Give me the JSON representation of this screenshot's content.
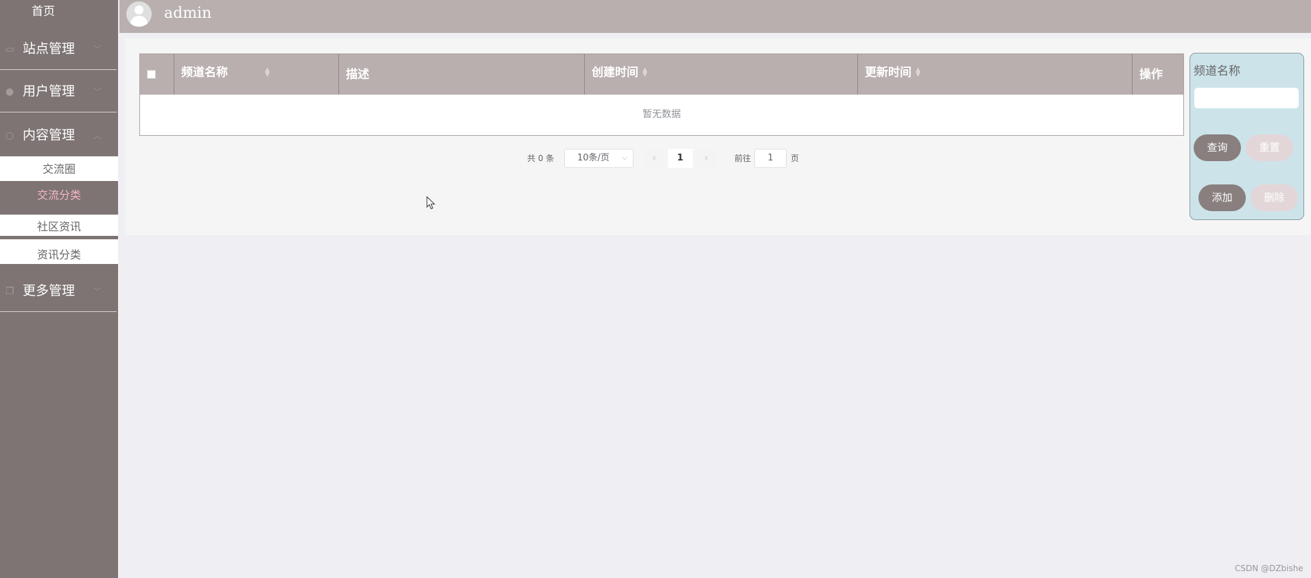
{
  "sidebar": {
    "home": "首页",
    "groups": [
      {
        "label": "站点管理",
        "icon": "monitor-icon",
        "arrow": "﹀"
      },
      {
        "label": "用户管理",
        "icon": "user-icon",
        "arrow": "﹀"
      },
      {
        "label": "内容管理",
        "icon": "message-icon",
        "arrow": "︿"
      },
      {
        "label": "更多管理",
        "icon": "copy-icon",
        "arrow": "﹀"
      }
    ],
    "sub_items": [
      "交流圈",
      "交流分类",
      "社区资讯",
      "资讯分类"
    ],
    "active_sub": "交流分类"
  },
  "header": {
    "username": "admin"
  },
  "table": {
    "columns": [
      "频道名称",
      "描述",
      "创建时间",
      "更新时间",
      "操作"
    ],
    "empty_text": "暂无数据"
  },
  "pagination": {
    "total": "共 0 条",
    "page_size": "10条/页",
    "current_page": "1",
    "goto_label": "前往",
    "goto_value": "1",
    "page_suffix": "页"
  },
  "search": {
    "label": "频道名称",
    "query_button": "查询",
    "reset_button": "重置",
    "add_button": "添加",
    "delete_button": "删除"
  },
  "watermark": "CSDN @DZbishe",
  "colors": {
    "sidebar_bg": "#7d7473",
    "header_bg": "#b8afae",
    "active_text": "#f5b6c7",
    "search_panel_bg": "#cde3ea"
  }
}
